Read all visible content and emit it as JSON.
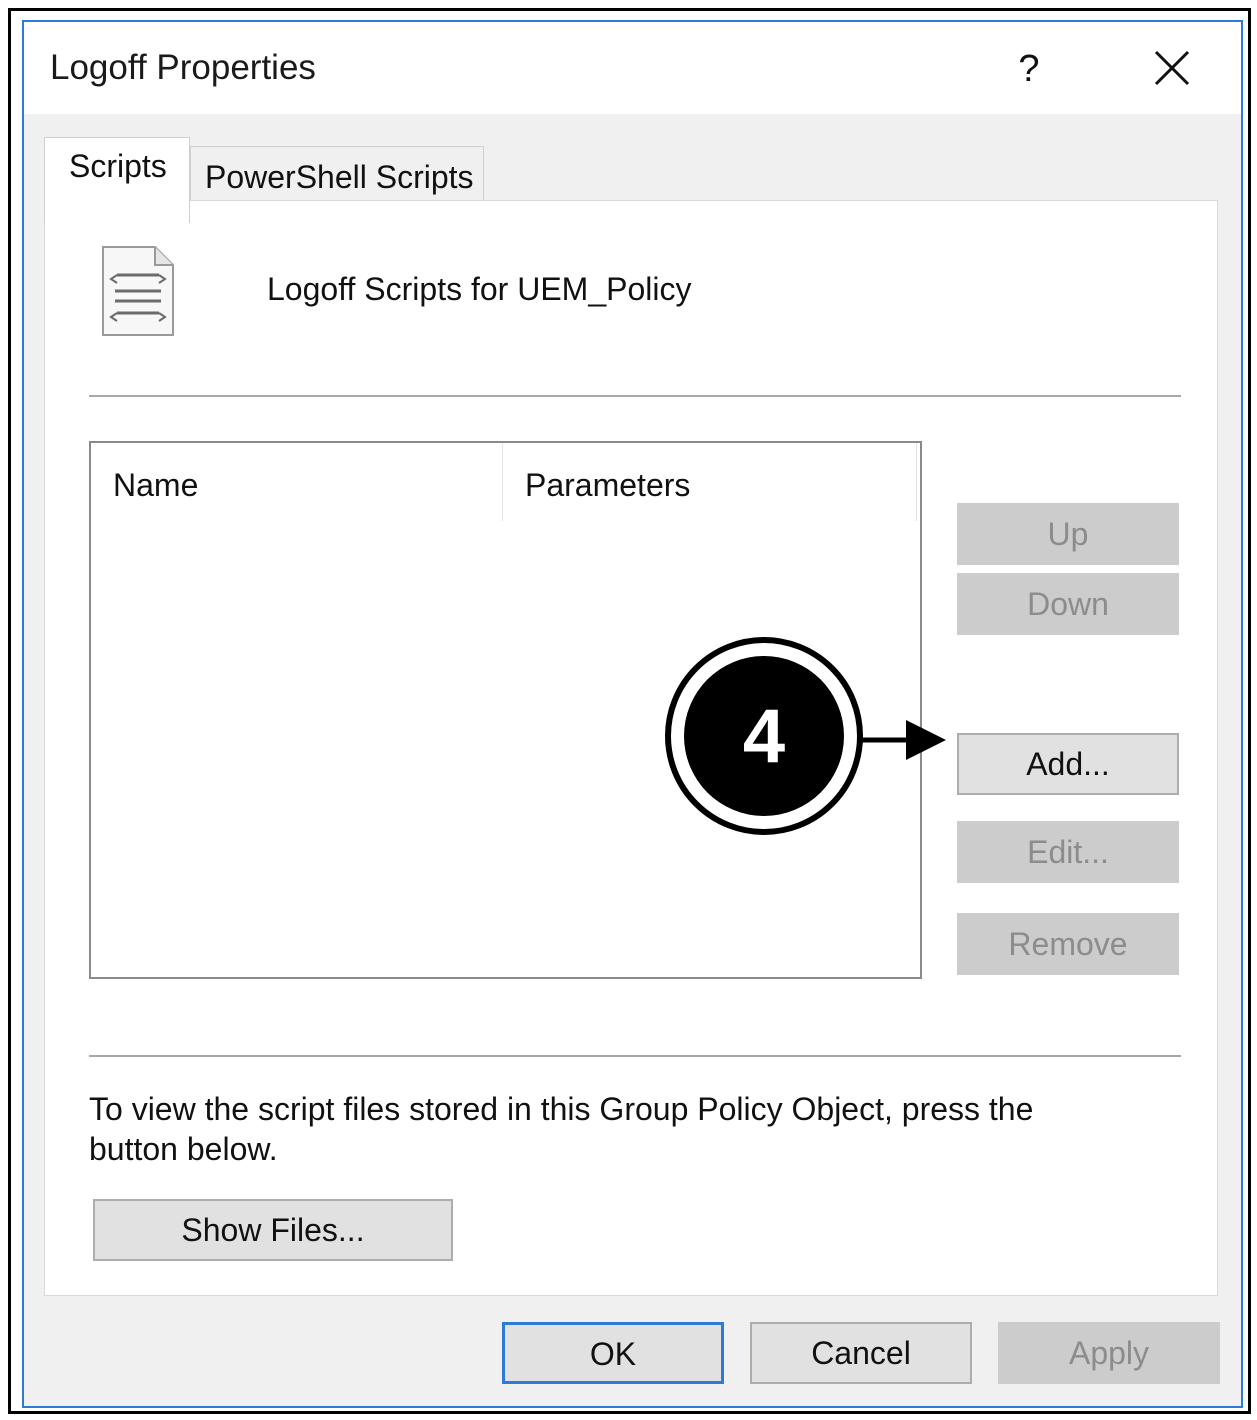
{
  "dialog": {
    "title": "Logoff Properties",
    "help_label": "?"
  },
  "tabs": [
    {
      "label": "Scripts",
      "active": true
    },
    {
      "label": "PowerShell Scripts",
      "active": false
    }
  ],
  "panel": {
    "heading": "Logoff Scripts for UEM_Policy",
    "icon": "script-file-icon",
    "list": {
      "columns": [
        "Name",
        "Parameters"
      ],
      "rows": []
    },
    "buttons": {
      "up": {
        "label": "Up",
        "enabled": false
      },
      "down": {
        "label": "Down",
        "enabled": false
      },
      "add": {
        "label": "Add...",
        "enabled": true
      },
      "edit": {
        "label": "Edit...",
        "enabled": false
      },
      "remove": {
        "label": "Remove",
        "enabled": false
      }
    },
    "instructions": "To view the script files stored in this Group Policy Object, press the button below.",
    "show_files_label": "Show Files..."
  },
  "footer": {
    "ok_label": "OK",
    "cancel_label": "Cancel",
    "apply_label": "Apply"
  },
  "callout": {
    "number": "4",
    "points_to": "Add..."
  },
  "colors": {
    "accent_blue": "#2c7bd6",
    "disabled_button": "#cccccc",
    "disabled_text": "#8c8c8c",
    "enabled_button": "#e1e1e1",
    "callout_fill": "#000000"
  }
}
